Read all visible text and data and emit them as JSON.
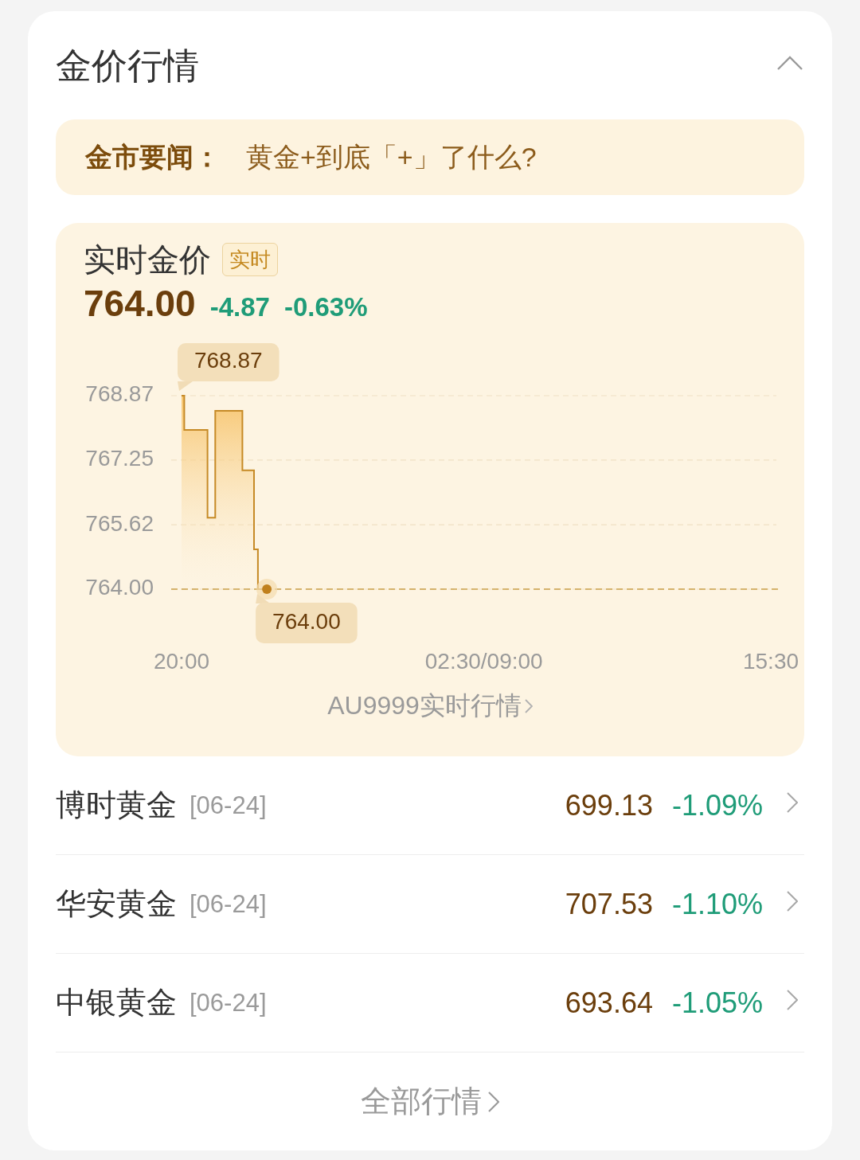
{
  "header": {
    "title": "金价行情",
    "expanded": true
  },
  "news": {
    "label": "金市要闻：",
    "headline": "黄金+到底「+」了什么?"
  },
  "realtime": {
    "title": "实时金价",
    "badge": "实时",
    "price": "764.00",
    "change": "-4.87",
    "change_pct": "-0.63%",
    "color": "#1f9c78",
    "chart_data": {
      "type": "area",
      "categories": [
        "20:00",
        null,
        null,
        null,
        null,
        null,
        null,
        null,
        null,
        null,
        null,
        null,
        null,
        null,
        null,
        null,
        null,
        null,
        null,
        null,
        null,
        null,
        null,
        null,
        null,
        null,
        null,
        null,
        null,
        null,
        null,
        null,
        null,
        null,
        null,
        null,
        null,
        null,
        null,
        null,
        null,
        null,
        null,
        null,
        null,
        null,
        null,
        null,
        null,
        null,
        null,
        null,
        null,
        null,
        null,
        null,
        null,
        null,
        null,
        null,
        null,
        null,
        null,
        null,
        null,
        null,
        null,
        null,
        null,
        null,
        null,
        null,
        null,
        null,
        null,
        null,
        null,
        null,
        "02:30/09:00",
        null,
        null,
        null,
        null,
        null,
        null,
        null,
        null,
        null,
        null,
        null,
        null,
        null,
        null,
        null,
        null,
        null,
        null,
        null,
        null,
        null,
        null,
        null,
        null,
        null,
        null,
        null,
        null,
        null,
        null,
        null,
        null,
        null,
        null,
        null,
        null,
        null,
        null,
        null,
        null,
        null,
        null,
        null,
        null,
        null,
        null,
        null,
        null,
        null,
        null,
        null,
        null,
        null,
        null,
        null,
        null,
        null,
        null,
        null,
        null,
        null,
        null,
        null,
        null,
        null,
        null,
        null,
        null,
        null,
        null,
        null,
        null,
        null,
        "15:30"
      ],
      "values": [
        768.87,
        768.01,
        768.01,
        768.01,
        768.01,
        768.01,
        768.01,
        765.8,
        765.8,
        768.49,
        768.49,
        768.49,
        768.49,
        768.49,
        768.49,
        768.49,
        766.99,
        766.99,
        766.99,
        765.0,
        764.0,
        764.0,
        764.0,
        null,
        null,
        null,
        null,
        null,
        null,
        null,
        null,
        null,
        null,
        null,
        null,
        null,
        null,
        null,
        null,
        null,
        null,
        null,
        null,
        null,
        null,
        null,
        null,
        null,
        null,
        null,
        null,
        null,
        null,
        null,
        null,
        null,
        null,
        null,
        null,
        null,
        null,
        null,
        null,
        null,
        null,
        null,
        null,
        null,
        null,
        null,
        null,
        null,
        null,
        null,
        null,
        null,
        null,
        null,
        null,
        null,
        null,
        null,
        null,
        null,
        null,
        null,
        null,
        null,
        null,
        null,
        null,
        null,
        null,
        null,
        null,
        null,
        null,
        null,
        null,
        null,
        null,
        null,
        null,
        null,
        null,
        null,
        null,
        null,
        null,
        null,
        null,
        null,
        null,
        null,
        null,
        null,
        null,
        null,
        null,
        null,
        null,
        null,
        null,
        null,
        null,
        null,
        null,
        null,
        null,
        null,
        null,
        null,
        null,
        null,
        null,
        null,
        null,
        null,
        null,
        null,
        null,
        null,
        null,
        null,
        null,
        null,
        null,
        null,
        null,
        null,
        null,
        null,
        null
      ],
      "ylim": [
        764.0,
        768.87
      ],
      "yticks": [
        {
          "value": 768.87,
          "label": "768.87"
        },
        {
          "value": 767.25,
          "label": "767.25"
        },
        {
          "value": 765.62,
          "label": "765.62"
        },
        {
          "value": 764.0,
          "label": "764.00"
        }
      ],
      "annotations": [
        "768.87",
        "764.00"
      ]
    },
    "link": "AU9999实时行情"
  },
  "products": [
    {
      "name": "博时黄金",
      "date": "[06-24]",
      "price": "699.13",
      "change_pct": "-1.09%",
      "color": "#1f9c78"
    },
    {
      "name": "华安黄金",
      "date": "[06-24]",
      "price": "707.53",
      "change_pct": "-1.10%",
      "color": "#1f9c78"
    },
    {
      "name": "中银黄金",
      "date": "[06-24]",
      "price": "693.64",
      "change_pct": "-1.05%",
      "color": "#1f9c78"
    }
  ],
  "footer_link": "全部行情"
}
